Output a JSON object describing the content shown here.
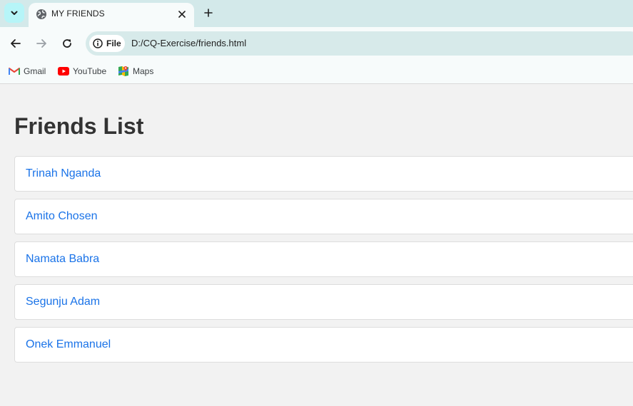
{
  "browser": {
    "tab": {
      "title": "MY FRIENDS"
    },
    "omnibox": {
      "chip_label": "File",
      "url": "D:/CQ-Exercise/friends.html"
    },
    "bookmarks": [
      {
        "label": "Gmail",
        "icon": "gmail-icon"
      },
      {
        "label": "YouTube",
        "icon": "youtube-icon"
      },
      {
        "label": "Maps",
        "icon": "maps-icon"
      }
    ]
  },
  "page": {
    "title": "Friends List",
    "friends": [
      {
        "name": "Trinah Nganda"
      },
      {
        "name": "Amito Chosen"
      },
      {
        "name": "Namata Babra"
      },
      {
        "name": "Segunju Adam"
      },
      {
        "name": "Onek Emmanuel"
      }
    ]
  },
  "colors": {
    "tabstrip": "#d3e9ea",
    "toolbar": "#f7fbfb",
    "omnibox": "#d7eaea",
    "page_background": "#f2f2f2",
    "heading": "#333333",
    "link": "#1a73e8",
    "card_border": "#dddddd"
  }
}
